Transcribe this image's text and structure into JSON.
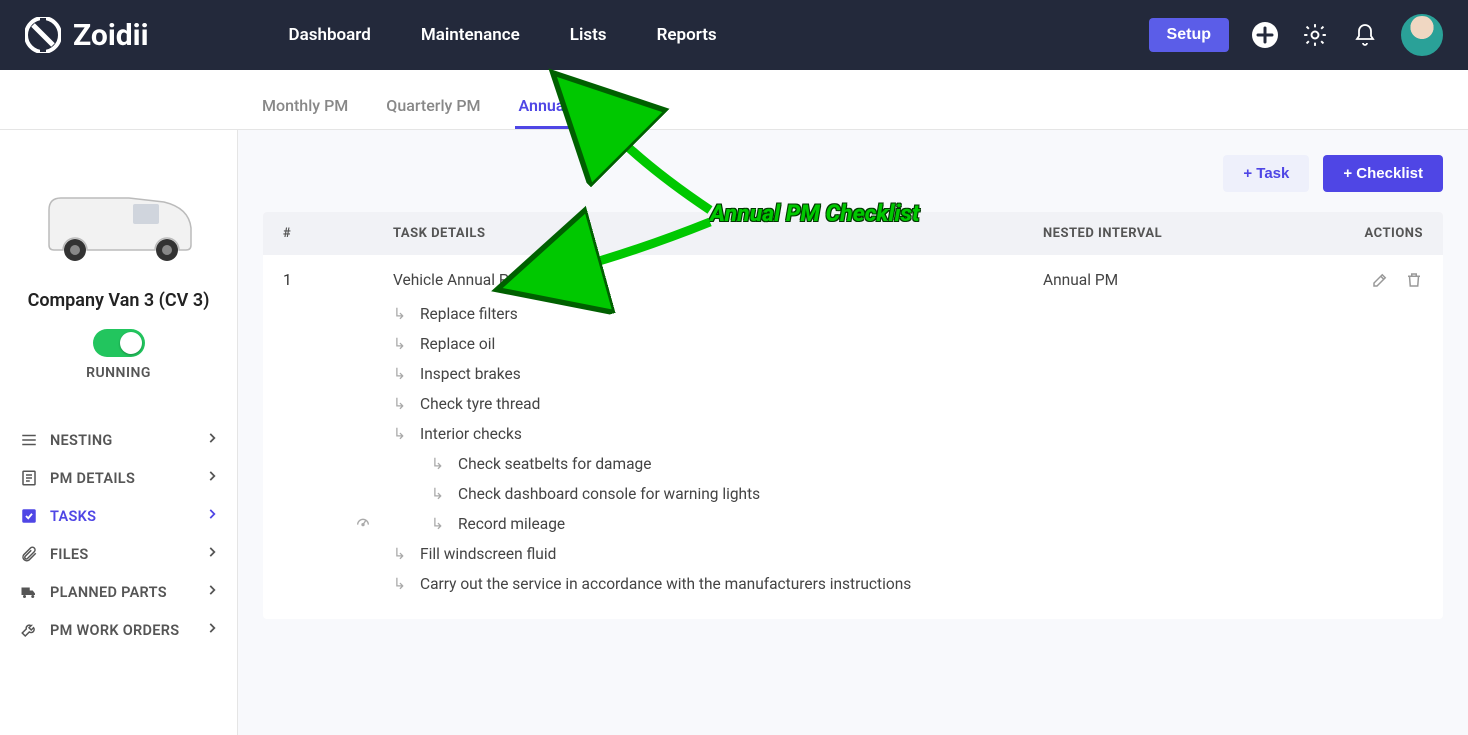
{
  "brand": "Zoidii",
  "nav": {
    "items": [
      "Dashboard",
      "Maintenance",
      "Lists",
      "Reports"
    ],
    "setup": "Setup"
  },
  "tabs": {
    "items": [
      "Monthly PM",
      "Quarterly PM",
      "Annual PM"
    ],
    "activeIndex": 2
  },
  "asset": {
    "name": "Company Van 3 (CV 3)",
    "status": "RUNNING"
  },
  "sideMenu": {
    "items": [
      {
        "label": "NESTING"
      },
      {
        "label": "PM DETAILS"
      },
      {
        "label": "TASKS",
        "active": true
      },
      {
        "label": "FILES"
      },
      {
        "label": "PLANNED PARTS"
      },
      {
        "label": "PM WORK ORDERS"
      }
    ]
  },
  "buttons": {
    "addTask": "+ Task",
    "addChecklist": "+ Checklist"
  },
  "tableHead": {
    "num": "#",
    "details": "TASK DETAILS",
    "interval": "NESTED INTERVAL",
    "actions": "ACTIONS"
  },
  "row": {
    "num": "1",
    "title": "Vehicle Annual PM",
    "interval": "Annual PM",
    "subtasks": [
      "Replace filters",
      "Replace oil",
      "Inspect brakes",
      "Check tyre thread",
      "Interior checks"
    ],
    "nested": [
      {
        "label": "Check seatbelts for damage"
      },
      {
        "label": "Check dashboard console for warning lights"
      },
      {
        "label": "Record mileage",
        "meter": true
      }
    ],
    "subtasks2": [
      "Fill windscreen fluid",
      "Carry out the service in accordance with the manufacturers instructions"
    ]
  },
  "annotation": "Annual PM Checklist"
}
